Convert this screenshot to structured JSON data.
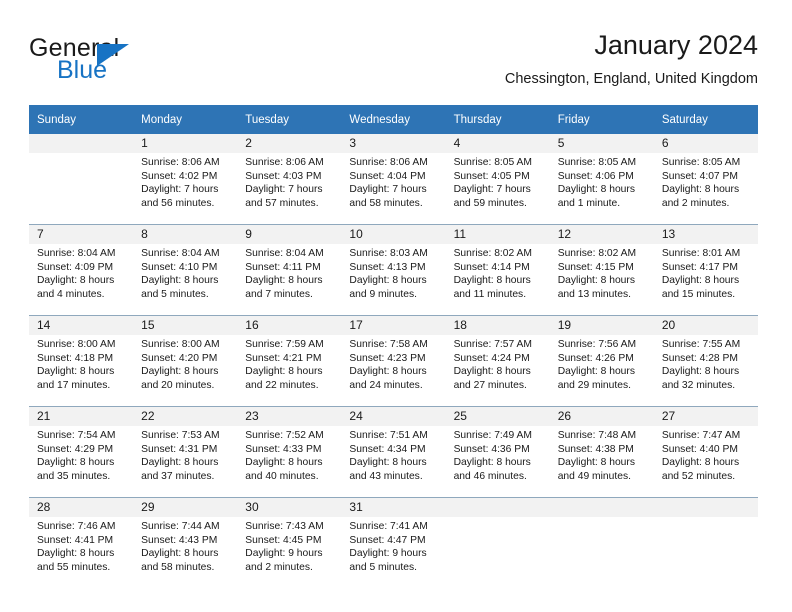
{
  "brand": {
    "name_part1": "General",
    "name_part2": "Blue",
    "accent_color": "#1773c4"
  },
  "header": {
    "title": "January 2024",
    "subtitle": "Chessington, England, United Kingdom"
  },
  "theme": {
    "header_row_bg": "#2e74b5",
    "daynum_band_bg": "#f2f2f2",
    "row_divider": "#8fa8bd"
  },
  "calendar": {
    "weekday_headers": [
      "Sunday",
      "Monday",
      "Tuesday",
      "Wednesday",
      "Thursday",
      "Friday",
      "Saturday"
    ],
    "weeks": [
      [
        {
          "day": "",
          "lines": []
        },
        {
          "day": "1",
          "lines": [
            "Sunrise: 8:06 AM",
            "Sunset: 4:02 PM",
            "Daylight: 7 hours",
            "and 56 minutes."
          ]
        },
        {
          "day": "2",
          "lines": [
            "Sunrise: 8:06 AM",
            "Sunset: 4:03 PM",
            "Daylight: 7 hours",
            "and 57 minutes."
          ]
        },
        {
          "day": "3",
          "lines": [
            "Sunrise: 8:06 AM",
            "Sunset: 4:04 PM",
            "Daylight: 7 hours",
            "and 58 minutes."
          ]
        },
        {
          "day": "4",
          "lines": [
            "Sunrise: 8:05 AM",
            "Sunset: 4:05 PM",
            "Daylight: 7 hours",
            "and 59 minutes."
          ]
        },
        {
          "day": "5",
          "lines": [
            "Sunrise: 8:05 AM",
            "Sunset: 4:06 PM",
            "Daylight: 8 hours",
            "and 1 minute."
          ]
        },
        {
          "day": "6",
          "lines": [
            "Sunrise: 8:05 AM",
            "Sunset: 4:07 PM",
            "Daylight: 8 hours",
            "and 2 minutes."
          ]
        }
      ],
      [
        {
          "day": "7",
          "lines": [
            "Sunrise: 8:04 AM",
            "Sunset: 4:09 PM",
            "Daylight: 8 hours",
            "and 4 minutes."
          ]
        },
        {
          "day": "8",
          "lines": [
            "Sunrise: 8:04 AM",
            "Sunset: 4:10 PM",
            "Daylight: 8 hours",
            "and 5 minutes."
          ]
        },
        {
          "day": "9",
          "lines": [
            "Sunrise: 8:04 AM",
            "Sunset: 4:11 PM",
            "Daylight: 8 hours",
            "and 7 minutes."
          ]
        },
        {
          "day": "10",
          "lines": [
            "Sunrise: 8:03 AM",
            "Sunset: 4:13 PM",
            "Daylight: 8 hours",
            "and 9 minutes."
          ]
        },
        {
          "day": "11",
          "lines": [
            "Sunrise: 8:02 AM",
            "Sunset: 4:14 PM",
            "Daylight: 8 hours",
            "and 11 minutes."
          ]
        },
        {
          "day": "12",
          "lines": [
            "Sunrise: 8:02 AM",
            "Sunset: 4:15 PM",
            "Daylight: 8 hours",
            "and 13 minutes."
          ]
        },
        {
          "day": "13",
          "lines": [
            "Sunrise: 8:01 AM",
            "Sunset: 4:17 PM",
            "Daylight: 8 hours",
            "and 15 minutes."
          ]
        }
      ],
      [
        {
          "day": "14",
          "lines": [
            "Sunrise: 8:00 AM",
            "Sunset: 4:18 PM",
            "Daylight: 8 hours",
            "and 17 minutes."
          ]
        },
        {
          "day": "15",
          "lines": [
            "Sunrise: 8:00 AM",
            "Sunset: 4:20 PM",
            "Daylight: 8 hours",
            "and 20 minutes."
          ]
        },
        {
          "day": "16",
          "lines": [
            "Sunrise: 7:59 AM",
            "Sunset: 4:21 PM",
            "Daylight: 8 hours",
            "and 22 minutes."
          ]
        },
        {
          "day": "17",
          "lines": [
            "Sunrise: 7:58 AM",
            "Sunset: 4:23 PM",
            "Daylight: 8 hours",
            "and 24 minutes."
          ]
        },
        {
          "day": "18",
          "lines": [
            "Sunrise: 7:57 AM",
            "Sunset: 4:24 PM",
            "Daylight: 8 hours",
            "and 27 minutes."
          ]
        },
        {
          "day": "19",
          "lines": [
            "Sunrise: 7:56 AM",
            "Sunset: 4:26 PM",
            "Daylight: 8 hours",
            "and 29 minutes."
          ]
        },
        {
          "day": "20",
          "lines": [
            "Sunrise: 7:55 AM",
            "Sunset: 4:28 PM",
            "Daylight: 8 hours",
            "and 32 minutes."
          ]
        }
      ],
      [
        {
          "day": "21",
          "lines": [
            "Sunrise: 7:54 AM",
            "Sunset: 4:29 PM",
            "Daylight: 8 hours",
            "and 35 minutes."
          ]
        },
        {
          "day": "22",
          "lines": [
            "Sunrise: 7:53 AM",
            "Sunset: 4:31 PM",
            "Daylight: 8 hours",
            "and 37 minutes."
          ]
        },
        {
          "day": "23",
          "lines": [
            "Sunrise: 7:52 AM",
            "Sunset: 4:33 PM",
            "Daylight: 8 hours",
            "and 40 minutes."
          ]
        },
        {
          "day": "24",
          "lines": [
            "Sunrise: 7:51 AM",
            "Sunset: 4:34 PM",
            "Daylight: 8 hours",
            "and 43 minutes."
          ]
        },
        {
          "day": "25",
          "lines": [
            "Sunrise: 7:49 AM",
            "Sunset: 4:36 PM",
            "Daylight: 8 hours",
            "and 46 minutes."
          ]
        },
        {
          "day": "26",
          "lines": [
            "Sunrise: 7:48 AM",
            "Sunset: 4:38 PM",
            "Daylight: 8 hours",
            "and 49 minutes."
          ]
        },
        {
          "day": "27",
          "lines": [
            "Sunrise: 7:47 AM",
            "Sunset: 4:40 PM",
            "Daylight: 8 hours",
            "and 52 minutes."
          ]
        }
      ],
      [
        {
          "day": "28",
          "lines": [
            "Sunrise: 7:46 AM",
            "Sunset: 4:41 PM",
            "Daylight: 8 hours",
            "and 55 minutes."
          ]
        },
        {
          "day": "29",
          "lines": [
            "Sunrise: 7:44 AM",
            "Sunset: 4:43 PM",
            "Daylight: 8 hours",
            "and 58 minutes."
          ]
        },
        {
          "day": "30",
          "lines": [
            "Sunrise: 7:43 AM",
            "Sunset: 4:45 PM",
            "Daylight: 9 hours",
            "and 2 minutes."
          ]
        },
        {
          "day": "31",
          "lines": [
            "Sunrise: 7:41 AM",
            "Sunset: 4:47 PM",
            "Daylight: 9 hours",
            "and 5 minutes."
          ]
        },
        {
          "day": "",
          "lines": []
        },
        {
          "day": "",
          "lines": []
        },
        {
          "day": "",
          "lines": []
        }
      ]
    ]
  }
}
